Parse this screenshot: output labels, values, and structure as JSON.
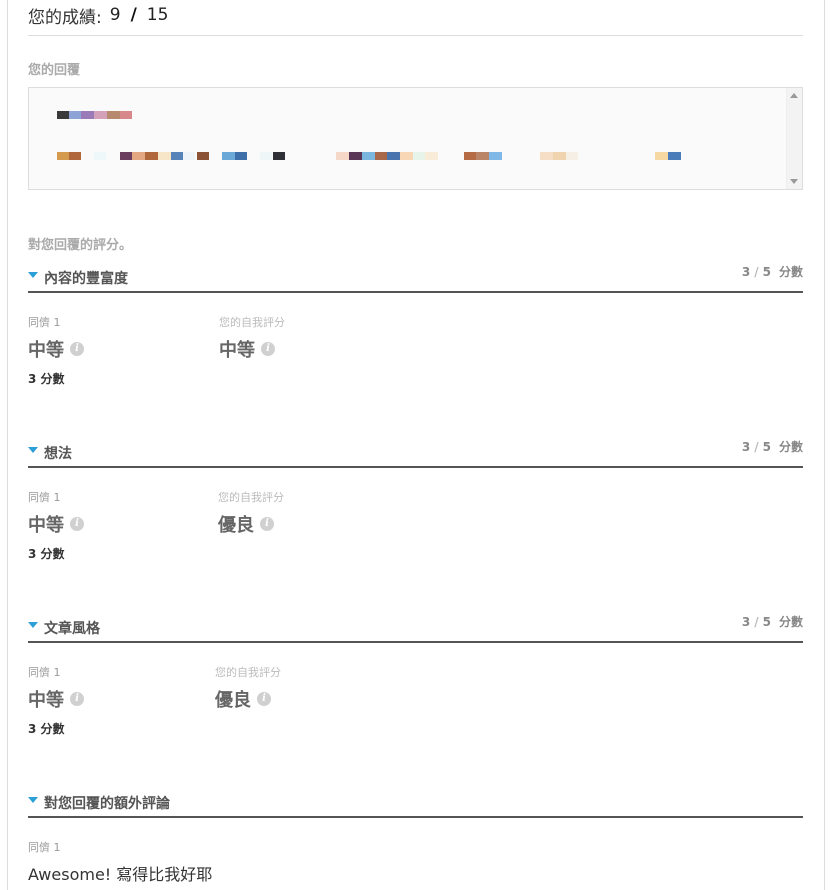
{
  "score": {
    "label": "您的成績:",
    "earned": "9",
    "total": "15"
  },
  "response_label": "您的回覆",
  "evaluation_label": "對您回覆的評分。",
  "criteria": [
    {
      "title": "內容的豐富度",
      "score": "3",
      "max": "5",
      "unit": "分數",
      "peer_label": "同儕 1",
      "peer_value": "中等",
      "self_label": "您的自我評分",
      "self_value": "中等",
      "points_text": "3 分數"
    },
    {
      "title": "想法",
      "score": "3",
      "max": "5",
      "unit": "分數",
      "peer_label": "同儕 1",
      "peer_value": "中等",
      "self_label": "您的自我評分",
      "self_value": "優良",
      "points_text": "3 分數"
    },
    {
      "title": "文章風格",
      "score": "3",
      "max": "5",
      "unit": "分數",
      "peer_label": "同儕 1",
      "peer_value": "中等",
      "self_label": "您的自我評分",
      "self_value": "優良",
      "points_text": "3 分數"
    }
  ],
  "additional": {
    "title": "對您回覆的額外評論",
    "peer_label": "同儕 1",
    "comment": "Awesome! 寫得比我好耶"
  },
  "colors": {
    "accent": "#2b9fd6",
    "rule": "#555555"
  },
  "icons": {
    "info": "info-icon",
    "expand": "triangle-down-icon"
  }
}
